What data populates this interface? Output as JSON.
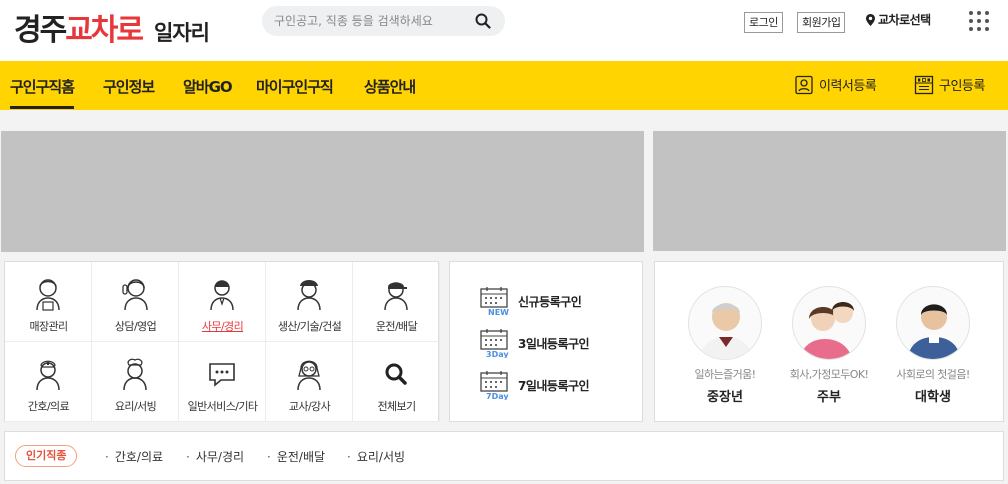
{
  "header": {
    "logo_part1": "경주",
    "logo_part2": "교차로",
    "logo_sub": "일자리",
    "search_placeholder": "구인공고, 직종 등을 검색하세요",
    "login": "로그인",
    "signup": "회원가입",
    "region_select": "교차로선택"
  },
  "nav": {
    "tabs": [
      "구인구직홈",
      "구인정보",
      "알바GO",
      "마이구인구직",
      "상품안내"
    ],
    "resume_register": "이력서등록",
    "job_register": "구인등록"
  },
  "categories": [
    {
      "label": "매장관리",
      "icon": "store-staff-icon"
    },
    {
      "label": "상담/영업",
      "icon": "call-agent-icon"
    },
    {
      "label": "사무/경리",
      "icon": "office-worker-icon"
    },
    {
      "label": "생산/기술/건설",
      "icon": "construction-worker-icon"
    },
    {
      "label": "운전/배달",
      "icon": "driver-icon"
    },
    {
      "label": "간호/의료",
      "icon": "nurse-icon"
    },
    {
      "label": "요리/서빙",
      "icon": "cook-icon"
    },
    {
      "label": "일반서비스/기타",
      "icon": "chat-bubble-icon"
    },
    {
      "label": "교사/강사",
      "icon": "teacher-icon"
    },
    {
      "label": "전체보기",
      "icon": "search-icon"
    }
  ],
  "registrations": [
    {
      "label": "신규등록구인",
      "badge": "NEW"
    },
    {
      "label": "3일내등록구인",
      "badge": "3Day"
    },
    {
      "label": "7일내등록구인",
      "badge": "7Day"
    }
  ],
  "people": [
    {
      "tag": "일하는즐거움!",
      "name": "중장년"
    },
    {
      "tag": "회사,가정모두OK!",
      "name": "주부"
    },
    {
      "tag": "사회로의 첫걸음!",
      "name": "대학생"
    }
  ],
  "popular": {
    "badge": "인기직종",
    "items": [
      "간호/의료",
      "사무/경리",
      "운전/배달",
      "요리/서빙"
    ]
  },
  "colors": {
    "nav_bg": "#ffd400",
    "accent_red": "#e8373a",
    "banner_gray": "#c2c2c2",
    "calendar_blue": "#4a90e2"
  }
}
